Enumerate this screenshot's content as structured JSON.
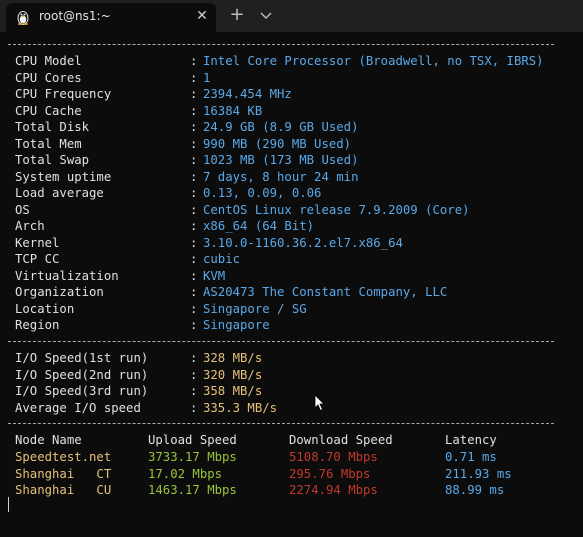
{
  "window": {
    "tab_title": "root@ns1:~",
    "close_glyph": "✕",
    "newtab_glyph": "+",
    "icons": {
      "tab": "linux-penguin-icon",
      "close": "close-icon",
      "newtab": "plus-icon",
      "dropdown": "chevron-down-icon"
    }
  },
  "system_info": {
    "separator": ":",
    "rows": [
      {
        "key": "CPU Model",
        "value": "Intel Core Processor (Broadwell, no TSX, IBRS)"
      },
      {
        "key": "CPU Cores",
        "value": "1"
      },
      {
        "key": "CPU Frequency",
        "value": "2394.454 MHz"
      },
      {
        "key": "CPU Cache",
        "value": "16384 KB"
      },
      {
        "key": "Total Disk",
        "value": "24.9 GB (8.9 GB Used)"
      },
      {
        "key": "Total Mem",
        "value": "990 MB (290 MB Used)"
      },
      {
        "key": "Total Swap",
        "value": "1023 MB (173 MB Used)"
      },
      {
        "key": "System uptime",
        "value": "7 days, 8 hour 24 min"
      },
      {
        "key": "Load average",
        "value": "0.13, 0.09, 0.06"
      },
      {
        "key": "OS",
        "value": "CentOS Linux release 7.9.2009 (Core)"
      },
      {
        "key": "Arch",
        "value": "x86_64 (64 Bit)"
      },
      {
        "key": "Kernel",
        "value": "3.10.0-1160.36.2.el7.x86_64"
      },
      {
        "key": "TCP CC",
        "value": "cubic"
      },
      {
        "key": "Virtualization",
        "value": "KVM"
      },
      {
        "key": "Organization",
        "value": "AS20473 The Constant Company, LLC"
      },
      {
        "key": "Location",
        "value": "Singapore / SG"
      },
      {
        "key": "Region",
        "value": "Singapore"
      }
    ]
  },
  "io_speed": {
    "rows": [
      {
        "key": "I/O Speed(1st run)",
        "value": "328 MB/s"
      },
      {
        "key": "I/O Speed(2nd run)",
        "value": "320 MB/s"
      },
      {
        "key": "I/O Speed(3rd run)",
        "value": "358 MB/s"
      },
      {
        "key": "Average I/O speed",
        "value": "335.3 MB/s"
      }
    ]
  },
  "speedtest": {
    "headers": {
      "node": "Node Name",
      "upload": "Upload Speed",
      "download": "Download Speed",
      "latency": "Latency"
    },
    "rows": [
      {
        "node": "Speedtest.net",
        "upload": "3733.17 Mbps",
        "download": "5108.70 Mbps",
        "latency": "0.71 ms"
      },
      {
        "node": "Shanghai   CT",
        "upload": "17.02 Mbps",
        "download": "295.76 Mbps",
        "latency": "211.93 ms"
      },
      {
        "node": "Shanghai   CU",
        "upload": "1463.17 Mbps",
        "download": "2274.94 Mbps",
        "latency": "88.99 ms"
      }
    ]
  },
  "colors": {
    "background": "#0c0c0c",
    "value_blue": "#5aa8e8",
    "value_yellow": "#e5c07b",
    "value_green": "#98c33a",
    "value_red": "#c0392b"
  }
}
